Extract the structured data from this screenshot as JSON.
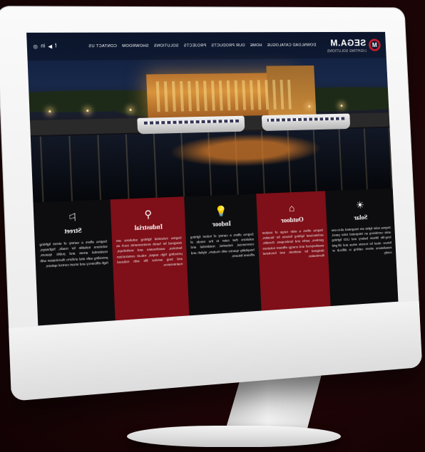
{
  "site": {
    "logo_mark": "M",
    "logo_name": "SEGA.M",
    "logo_sub": "LIGHTING SOLUTIONS",
    "menu": [
      "DOWNLOAD CATALOGUE",
      "HOME",
      "OUR PRODUCTS",
      "PROJECTS",
      "SOLUTIONS",
      "SHOWROOM",
      "CONTACT US"
    ],
    "social": [
      "f",
      "▶",
      "in",
      "◎"
    ]
  },
  "cards": [
    {
      "title": "Solar",
      "icon": "solar-icon",
      "glyph": "☀",
      "theme": "dark",
      "body": "Segma solar lights are integrated all-in-one units combining an integrated solar panel, long-life lithium battery and LED lighting fixture. Ideal for remote areas and off-grid installations where cabling is difficult or costly."
    },
    {
      "title": "Outdoor",
      "icon": "outdoor-lamp-icon",
      "glyph": "⌂",
      "theme": "red",
      "body": "Segma offers a wide range of outdoor architectural lighting fixtures for facades, gardens, parks and landscapes. Durable, weatherproof and energy efficient solutions designed for aesthetic and functional illumination."
    },
    {
      "title": "Indoor",
      "icon": "bulb-icon",
      "glyph": "💡",
      "theme": "dark",
      "body": "Segma offers a variety of indoor lighting solutions that cater to the needs of commercial, industrial, residential and hospitality spaces with modern, stylish and efficient fixtures."
    },
    {
      "title": "Industrial",
      "icon": "industrial-lamp-icon",
      "glyph": "⚲",
      "theme": "red",
      "body": "Segma industrial lighting solutions are designed for harsh environments such as factories, warehouses and workshops, providing high output, robust construction and long service life with reduced maintenance."
    },
    {
      "title": "Street",
      "icon": "street-lamp-icon",
      "glyph": "⚐",
      "theme": "dark",
      "body": "Segma offers a variety of street lighting solutions suitable for roads, highways, residential areas and public spaces, providing safe and uniform illumination with high efficiency and smart control options."
    }
  ]
}
